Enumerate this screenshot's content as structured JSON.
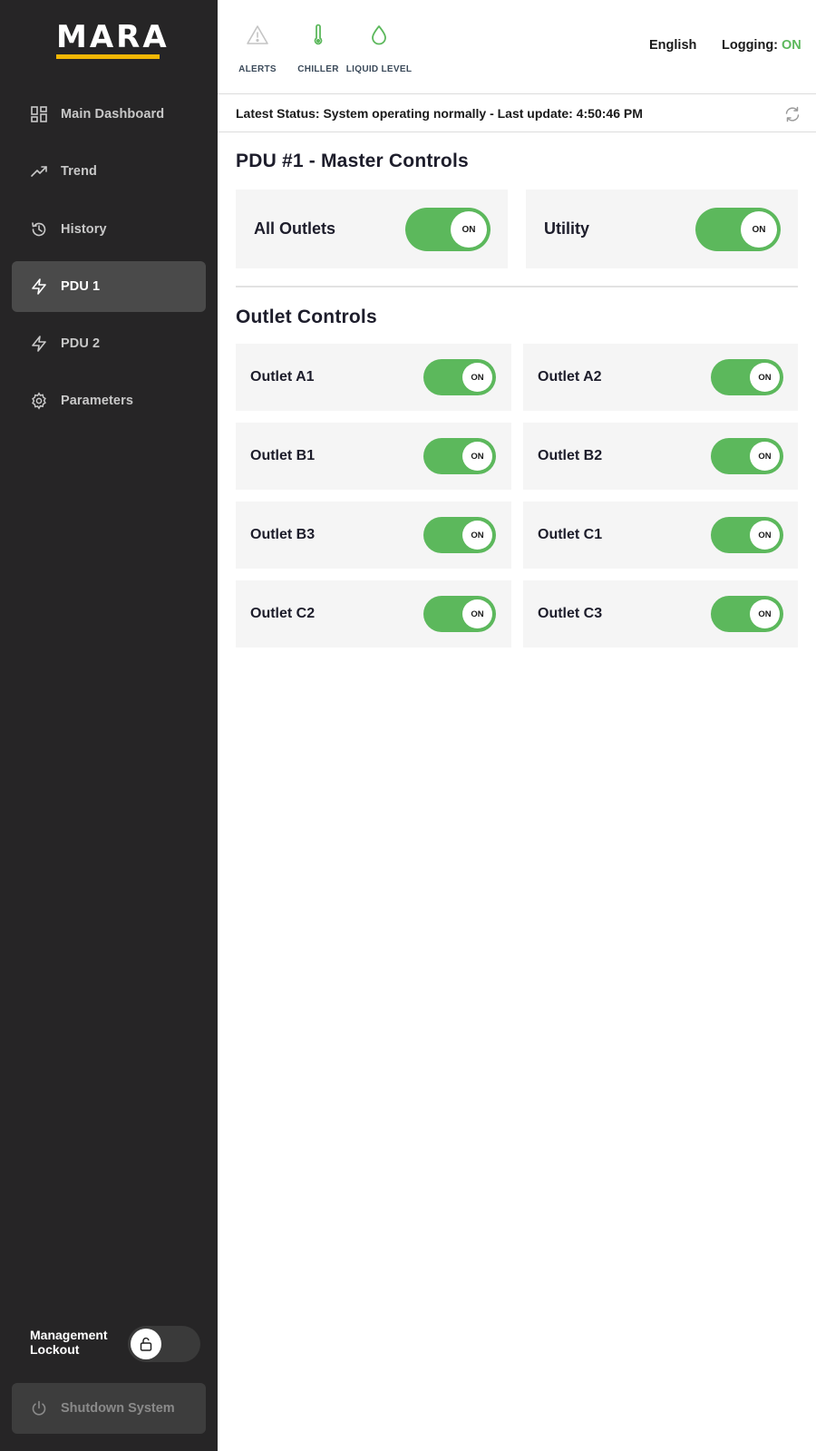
{
  "brand": {
    "name": "MARA",
    "accent": "#f2b705"
  },
  "sidebar": {
    "items": [
      {
        "label": "Main Dashboard",
        "icon": "grid-icon"
      },
      {
        "label": "Trend",
        "icon": "trend-icon"
      },
      {
        "label": "History",
        "icon": "history-icon"
      },
      {
        "label": "PDU 1",
        "icon": "bolt-icon",
        "active": true
      },
      {
        "label": "PDU 2",
        "icon": "bolt-icon"
      },
      {
        "label": "Parameters",
        "icon": "gear-icon"
      }
    ],
    "lockout": {
      "label_line1": "Management",
      "label_line2": "Lockout",
      "icon": "unlock-icon",
      "locked": false
    },
    "shutdown": {
      "label": "Shutdown System",
      "icon": "power-icon"
    }
  },
  "header": {
    "indicators": [
      {
        "label": "ALERTS",
        "icon": "alert-triangle-icon",
        "color": "#bdbdbd"
      },
      {
        "label": "CHILLER",
        "icon": "thermometer-icon",
        "color": "#5cb85c"
      },
      {
        "label": "LIQUID LEVEL",
        "icon": "droplet-icon",
        "color": "#5cb85c"
      }
    ],
    "language": "English",
    "logging_label": "Logging:",
    "logging_value": "ON"
  },
  "status": {
    "text": "Latest Status: System operating normally - Last update: 4:50:46 PM",
    "refresh_icon": "refresh-icon"
  },
  "master": {
    "title": "PDU #1 - Master Controls",
    "controls": [
      {
        "label": "All Outlets",
        "state": "ON"
      },
      {
        "label": "Utility",
        "state": "ON"
      }
    ]
  },
  "outlets": {
    "title": "Outlet Controls",
    "items": [
      {
        "label": "Outlet A1",
        "state": "ON"
      },
      {
        "label": "Outlet A2",
        "state": "ON"
      },
      {
        "label": "Outlet B1",
        "state": "ON"
      },
      {
        "label": "Outlet B2",
        "state": "ON"
      },
      {
        "label": "Outlet B3",
        "state": "ON"
      },
      {
        "label": "Outlet C1",
        "state": "ON"
      },
      {
        "label": "Outlet C2",
        "state": "ON"
      },
      {
        "label": "Outlet C3",
        "state": "ON"
      }
    ]
  },
  "colors": {
    "sidebar_bg": "#262526",
    "toggle_on": "#5cb85c",
    "card_bg": "#f5f5f5"
  }
}
